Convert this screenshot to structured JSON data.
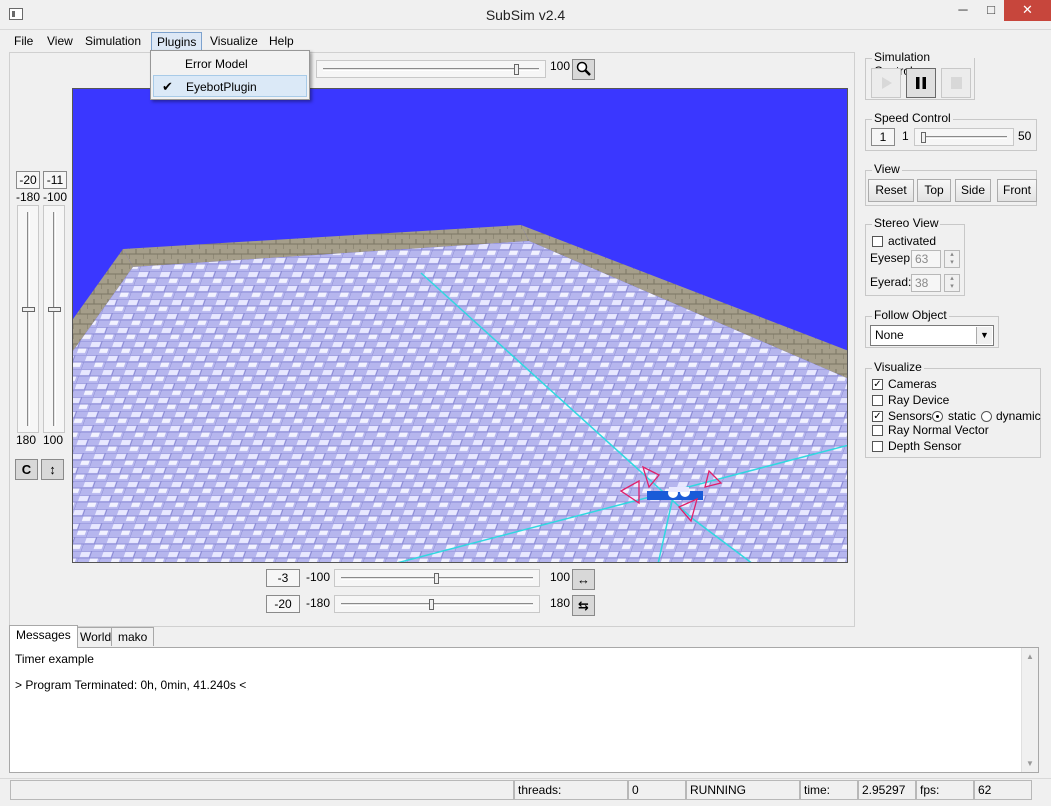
{
  "window": {
    "title": "SubSim v2.4",
    "minimize_glyph": "─",
    "maximize_glyph": "□",
    "close_glyph": "✕"
  },
  "menubar": [
    {
      "label": "File"
    },
    {
      "label": "View"
    },
    {
      "label": "Simulation"
    },
    {
      "label": "Plugins"
    },
    {
      "label": "Visualize"
    },
    {
      "label": "Help"
    }
  ],
  "plugins_menu": {
    "items": [
      {
        "label": "Error Model",
        "checked": false
      },
      {
        "label": "EyebotPlugin",
        "checked": true
      }
    ],
    "check_glyph": "✔"
  },
  "camera": {
    "zoom": {
      "max": "100",
      "value": 90,
      "icon": "magnifier-icon"
    },
    "left_sliders": {
      "v1": {
        "value": "-20",
        "min": "-180",
        "max": "180"
      },
      "v2": {
        "value": "-11",
        "min": "-100",
        "max": "100"
      },
      "buttons": [
        {
          "icon": "rotate-c-icon",
          "glyph": "C"
        },
        {
          "icon": "vertical-move-icon",
          "glyph": "↕"
        }
      ]
    },
    "bottom_sliders": {
      "h1": {
        "value": "-3",
        "min": "-100",
        "max": "100",
        "icon": "horizontal-move-icon",
        "glyph": "↔"
      },
      "h2": {
        "value": "-20",
        "min": "-180",
        "max": "180",
        "icon": "horizontal-rotate-icon",
        "glyph": "⇆"
      }
    }
  },
  "right": {
    "simulation_control": {
      "title": "Simulation Control"
    },
    "speed_control": {
      "title": "Speed Control",
      "value": "1",
      "min": "1",
      "max": "50"
    },
    "view": {
      "title": "View",
      "buttons": [
        "Reset",
        "Top",
        "Side",
        "Front"
      ]
    },
    "stereo_view": {
      "title": "Stereo View",
      "activated_label": "activated",
      "activated": false,
      "eyesep_label": "Eyesep:",
      "eyesep": "63",
      "eyerad_label": "Eyerad:",
      "eyerad": "38"
    },
    "follow_object": {
      "title": "Follow Object",
      "selected": "None"
    },
    "visualize": {
      "title": "Visualize",
      "cameras": "Cameras",
      "cameras_checked": true,
      "ray_device": "Ray Device",
      "sensors": "Sensors",
      "sensors_checked": true,
      "static": "static",
      "dynamic": "dynamic",
      "ray_normal": "Ray Normal Vector",
      "depth_sensor": "Depth Sensor"
    }
  },
  "tabs": [
    "Messages",
    "World",
    "mako"
  ],
  "messages": {
    "line1": "Timer example",
    "line2": "> Program Terminated: 0h, 0min, 41.240s <"
  },
  "status": {
    "threads_label": "threads:",
    "threads": "0",
    "state": "RUNNING",
    "time_label": "time:",
    "time": "2.95297",
    "fps_label": "fps:",
    "fps": "62"
  },
  "colors": {
    "viewport_bg": "#3a37ff",
    "pool_tile": "#b8b8f0",
    "wall": "#9a9482",
    "axis": "#30d8e0"
  }
}
